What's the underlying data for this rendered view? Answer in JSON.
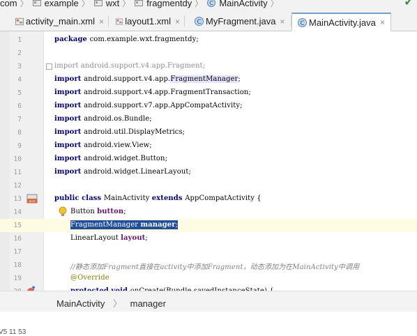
{
  "breadcrumb": {
    "items": [
      "com",
      "example",
      "wxt",
      "fragmentdy",
      "MainActivity"
    ]
  },
  "tabs": [
    {
      "label": "activity_main.xml",
      "icon": "xml-layout-icon",
      "active": false
    },
    {
      "label": "layout1.xml",
      "icon": "xml-layout-icon",
      "active": false
    },
    {
      "label": "MyFragment.java",
      "icon": "java-class-icon",
      "active": false
    },
    {
      "label": "MainActivity.java",
      "icon": "java-class-icon",
      "active": true
    }
  ],
  "tab_close_glyph": "×",
  "editor": {
    "lines": [
      {
        "n": "1",
        "code": "package com.example.wxt.fragmentdy;"
      },
      {
        "n": "2",
        "code": ""
      },
      {
        "n": "3",
        "code": "import android.support.v4.app.Fragment;"
      },
      {
        "n": "4",
        "code": "import android.support.v4.app.FragmentManager;"
      },
      {
        "n": "5",
        "code": "import android.support.v4.app.FragmentTransaction;"
      },
      {
        "n": "6",
        "code": "import android.support.v7.app.AppCompatActivity;"
      },
      {
        "n": "7",
        "code": "import android.os.Bundle;"
      },
      {
        "n": "8",
        "code": "import android.util.DisplayMetrics;"
      },
      {
        "n": "9",
        "code": "import android.view.View;"
      },
      {
        "n": "10",
        "code": "import android.widget.Button;"
      },
      {
        "n": "11",
        "code": "import android.widget.LinearLayout;"
      },
      {
        "n": "12",
        "code": ""
      },
      {
        "n": "13",
        "code": "public class MainActivity extends AppCompatActivity {"
      },
      {
        "n": "14",
        "code": "    Button button;"
      },
      {
        "n": "15",
        "code": "    FragmentManager manager;"
      },
      {
        "n": "16",
        "code": "    LinearLayout layout;"
      },
      {
        "n": "17",
        "code": ""
      },
      {
        "n": "18",
        "code": "    //静态添加Fragment直接在activity中添加Fragment，动态添加为在MainActivity中调用"
      },
      {
        "n": "19",
        "code": "    @Override"
      },
      {
        "n": "20",
        "code": "    protected void onCreate(Bundle savedInstanceState) {"
      }
    ],
    "caret_line": "15",
    "accent": "#1f4e9e"
  },
  "navbar": {
    "items": [
      "MainActivity",
      "manager"
    ]
  },
  "status": {
    "text": "V5 11 53"
  },
  "colors": {
    "keyword": "#000080",
    "field": "#660e7a",
    "comment": "#808080",
    "annotation": "#808000",
    "selection": "#1f4e9e",
    "active_tab_border": "#6f9dd8"
  }
}
